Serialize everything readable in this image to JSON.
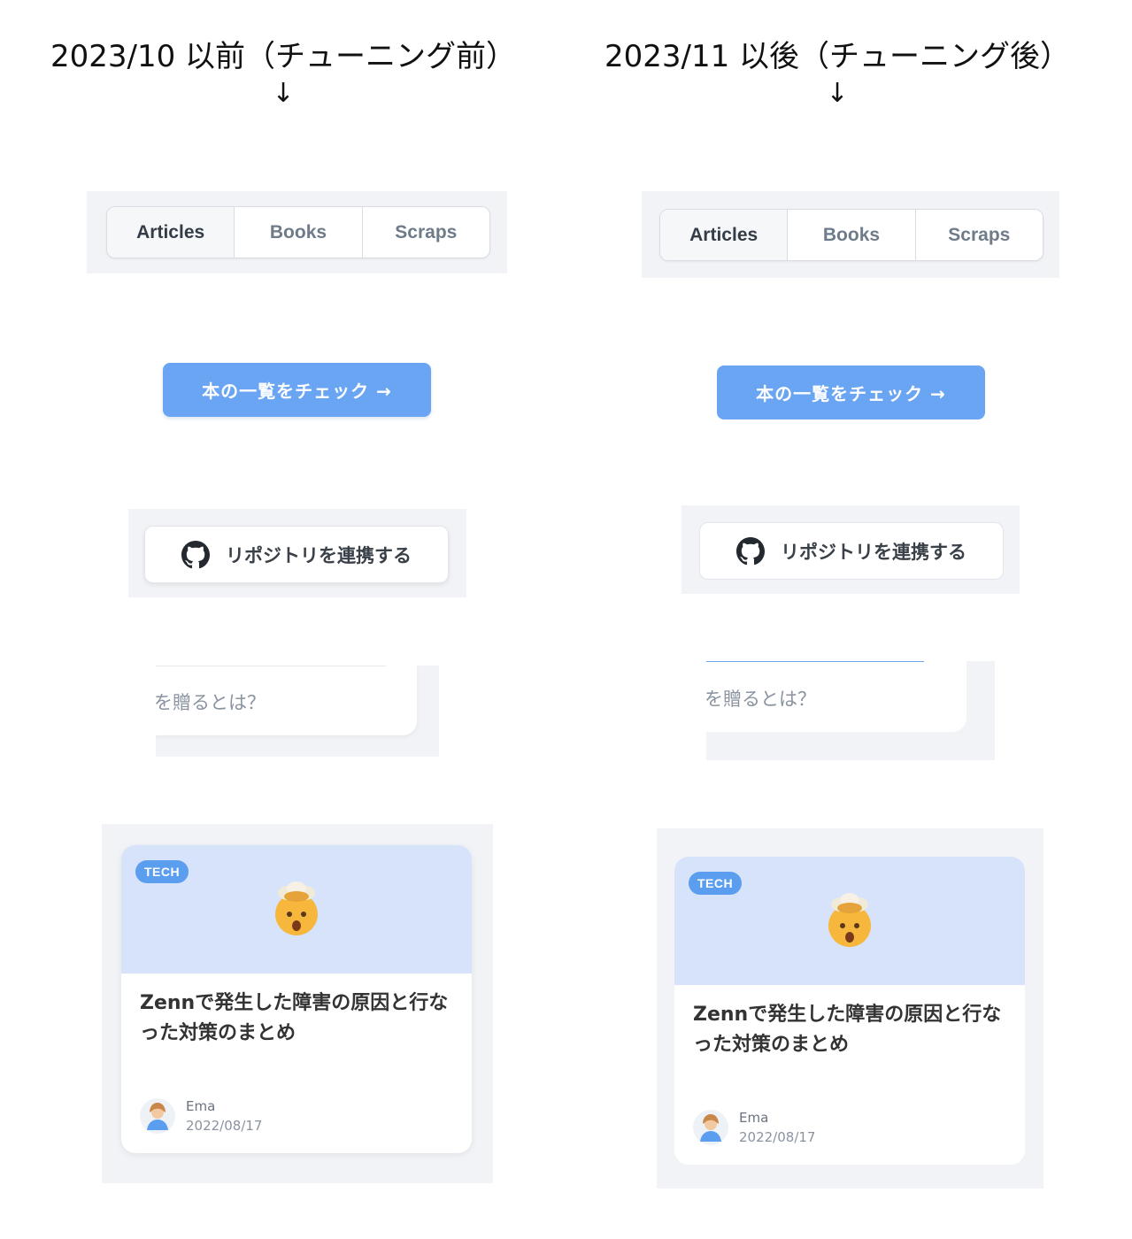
{
  "left": {
    "heading": "2023/10 以前（チューニング前）",
    "arrow": "↓"
  },
  "right": {
    "heading": "2023/11 以後（チューニング後）",
    "arrow": "↓"
  },
  "tabs": [
    "Articles",
    "Books",
    "Scraps"
  ],
  "book_button": {
    "label": "本の一覧をチェック →"
  },
  "github_button": {
    "label": "リポジトリを連携する",
    "icon": "github-icon"
  },
  "snippet": {
    "text": "を贈るとは？"
  },
  "card": {
    "tag": "TECH",
    "emoji": "exploding-head-icon",
    "title": "Zennで発生した障害の原因と行なった対策のまとめ",
    "author": "Ema",
    "date": "2022/08/17"
  },
  "colors": {
    "panel_bg": "#f1f3f7",
    "primary": "#6aa5f3",
    "card_top": "#d6e3fa",
    "tag_bg": "#5b9ef0"
  }
}
